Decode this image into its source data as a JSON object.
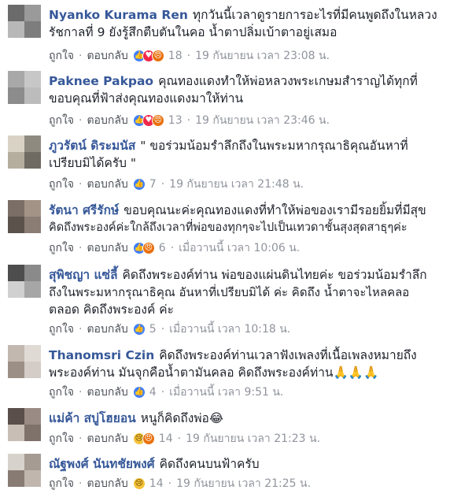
{
  "comments": [
    {
      "author": "Nyanko Kurama Ren",
      "text_line1": "ทุกวันนี้เวลาดูรายการอะไรที่มีคนพูดถึงในหลวง",
      "text_line2": "รัชกาลที่ 9 ยังรู้สึกตืบตันในคอ น้ำตาปลิ่มเบ้าตาอยู่เสมอ",
      "like": "ถูกใจ",
      "reply": "ตอบกลับ",
      "reactions": [
        "like",
        "love",
        "angry"
      ],
      "count": "18",
      "time": "19 กันยายน เวลา 23:08 น."
    },
    {
      "author": "Paknee Pakpao",
      "text_line1": "คุณทองแดงทำให้พ่อหลวงพระเกษมสำราญได้ทุกที่",
      "text_line2": "ขอบคุณที่ฟ้าส่งคุณทองแดงมาให้ท่าน",
      "like": "ถูกใจ",
      "reply": "ตอบกลับ",
      "reactions": [
        "like",
        "love",
        "angry"
      ],
      "count": "13",
      "time": "19 กันยายน เวลา 23:46 น."
    },
    {
      "author": "ภูวรัตน์ ดิระมนัส",
      "text_line1": "\" ขอร่วมน้อมรำลึกถึงในพระมหากรุณาธิคุณอันหาที่",
      "text_line2": "เปรียบมิได้ครับ \"",
      "like": "ถูกใจ",
      "reply": "ตอบกลับ",
      "reactions": [
        "like"
      ],
      "count": "7",
      "time": "19 กันยายน เวลา 21:48 น."
    },
    {
      "author": "รัตนา ศรีรักษ์",
      "text_line1": "ขอบคุณนะค่ะคุณทองแดงที่ทำให้พ่อของเรามีรอยยิ้มที่มีสุข",
      "text_line2": "คิดถึงพระองค์ค่ะใกล้ถึงเวลาที่พ่อของทุกๆจะไปเป็นเทวดาชั้นสุงสุดสาธุๆค่ะ",
      "like": "ถูกใจ",
      "reply": "ตอบกลับ",
      "reactions": [
        "like",
        "angry"
      ],
      "count": "6",
      "time": "เมื่อวานนี้ เวลา 10:06 น."
    },
    {
      "author": "สุพิชญา แซ่ลี้",
      "text_line1": "คิดถึงพระองค์ท่าน พ่อของแผ่นดินไทยค่ะ ขอร่วมน้อมรำลึก",
      "text_line2": "ถึงในพระมหากรุณาธิคุณ อันหาที่เปรียบมิได้ ค่ะ คิดถึง น้ำตาจะไหลคลอ",
      "text_line3": "ตลอด คิดถึงพระองค์ ค่ะ",
      "like": "ถูกใจ",
      "reply": "ตอบกลับ",
      "reactions": [
        "like"
      ],
      "count": "5",
      "time": "เมื่อวานนี้ เวลา 10:18 น."
    },
    {
      "author": "Thanomsri Czin",
      "text_line1": "คิดถึงพระองค์ท่านเวลาฟังเพลงที่เนื้อเพลงหมายถึง",
      "text_line2": "พระองค์ท่าน มันจุกคือน้ำตามันคลอ คิดถึงพระองค์ท่าน",
      "text_line2_emoji": "🙏🙏🙏",
      "like": "ถูกใจ",
      "reply": "ตอบกลับ",
      "reactions": [
        "like"
      ],
      "count": "4",
      "time": "เมื่อวานนี้ เวลา 9:51 น."
    },
    {
      "author": "แม่ค้า สบู่โฮยอน",
      "text_line1": "หนูก็คิดถึงพ่อ",
      "text_line1_emoji": "😂",
      "like": "ถูกใจ",
      "reply": "ตอบกลับ",
      "reactions": [
        "sad",
        "angry"
      ],
      "count": "14",
      "time": "19 กันยายน เวลา 21:23 น."
    },
    {
      "author": "ณัฐพงศ์ นันทชัยพงศ์",
      "text_line1": "คิดถึงคนบนฟ้าครับ",
      "like": "ถูกใจ",
      "reply": "ตอบกลับ",
      "reactions": [
        "sad"
      ],
      "count": "14",
      "time": "19 กันยายน เวลา 21:25 น."
    }
  ],
  "colors": {
    "author": "#365899",
    "meta": "#90949c",
    "text": "#1d2129",
    "like_reaction": "#4080ff",
    "love_reaction": "#f0284a",
    "angry_reaction": "#e9710f",
    "sad_reaction": "#f5c33b"
  }
}
